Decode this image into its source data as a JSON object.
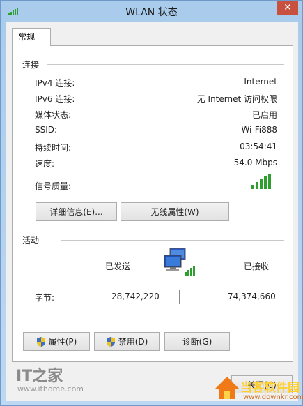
{
  "window": {
    "title": "WLAN 状态",
    "close_glyph": "✕"
  },
  "tab": {
    "label": "常规"
  },
  "connection": {
    "section_label": "连接",
    "rows": [
      {
        "label": "IPv4 连接:",
        "value": "Internet"
      },
      {
        "label": "IPv6 连接:",
        "value": "无 Internet 访问权限"
      },
      {
        "label": "媒体状态:",
        "value": "已启用"
      },
      {
        "label": "SSID:",
        "value": "Wi-Fi888"
      },
      {
        "label": "持续时间:",
        "value": "03:54:41"
      },
      {
        "label": "速度:",
        "value": "54.0 Mbps"
      },
      {
        "label": "信号质量:",
        "value": ""
      }
    ],
    "signal_bars": 5,
    "details_button": "详细信息(E)...",
    "wireless_props_button": "无线属性(W)"
  },
  "activity": {
    "section_label": "活动",
    "sent_label": "已发送",
    "received_label": "已接收",
    "bytes_label": "字节:",
    "bytes_sent": "28,742,220",
    "bytes_received": "74,374,660"
  },
  "buttons": {
    "properties": "属性(P)",
    "disable": "禁用(D)",
    "diagnose": "诊断(G)",
    "close": "关闭(C)"
  },
  "watermarks": {
    "ithome_logo": "IT之家",
    "ithome_url": "www.ithome.com",
    "downkr_text": "当客软件园",
    "downkr_url": "www.downkr.com"
  },
  "colors": {
    "signal_green": "#2e9e2e",
    "titlebar": "#b6d3f0",
    "close_red": "#c7503f"
  }
}
